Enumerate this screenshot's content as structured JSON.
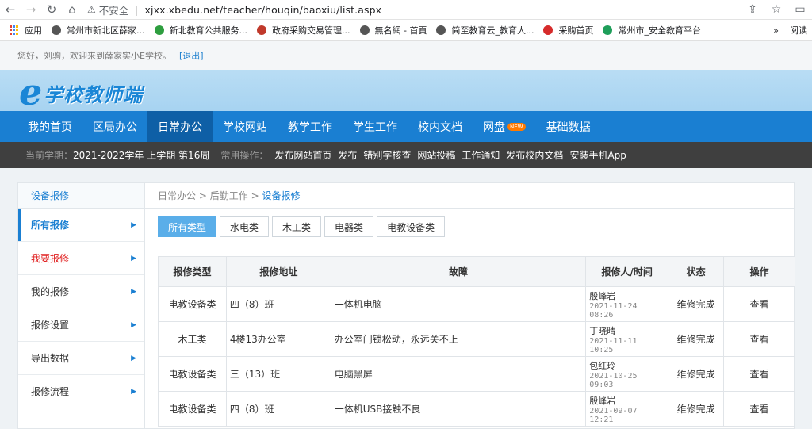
{
  "browser": {
    "insecure_label": "不安全",
    "url": "xjxx.xbedu.net/teacher/houqin/baoxiu/list.aspx",
    "bookmarks": [
      {
        "label": "应用",
        "color": "#e34133"
      },
      {
        "label": "常州市新北区薛家...",
        "color": "#555555"
      },
      {
        "label": "新北教育公共服务...",
        "color": "#2e9e3f"
      },
      {
        "label": "政府采购交易管理...",
        "color": "#c0392b"
      },
      {
        "label": "無名網 - 首頁",
        "color": "#555555"
      },
      {
        "label": "简至教育云_教育人...",
        "color": "#555555"
      },
      {
        "label": "采购首页",
        "color": "#d62b2b"
      },
      {
        "label": "常州市_安全教育平台",
        "color": "#1f9e5a"
      }
    ],
    "bookmarks_more": "»",
    "reading_list": "阅读"
  },
  "welcome": {
    "text": "您好，刘驹，欢迎来到薛家实小E学校。",
    "logout": "[退出]"
  },
  "logo": {
    "e": "e",
    "name": "学校教师端"
  },
  "main_nav": [
    {
      "label": "我的首页",
      "active": false,
      "badge": ""
    },
    {
      "label": "区局办公",
      "active": false,
      "badge": ""
    },
    {
      "label": "日常办公",
      "active": true,
      "badge": ""
    },
    {
      "label": "学校网站",
      "active": false,
      "badge": ""
    },
    {
      "label": "教学工作",
      "active": false,
      "badge": ""
    },
    {
      "label": "学生工作",
      "active": false,
      "badge": ""
    },
    {
      "label": "校内文档",
      "active": false,
      "badge": ""
    },
    {
      "label": "网盘",
      "active": false,
      "badge": "NEW"
    },
    {
      "label": "基础数据",
      "active": false,
      "badge": ""
    }
  ],
  "sub_nav": {
    "term_label": "当前学期：",
    "term": "2021-2022学年 上学期 第16周",
    "ops_label": "常用操作：",
    "ops": [
      "发布网站首页",
      "发布",
      "错别字核查",
      "网站投稿",
      "工作通知",
      "发布校内文档",
      "安装手机App"
    ]
  },
  "sidebar": {
    "title": "设备报修",
    "items": [
      {
        "label": "所有报修",
        "state": "active"
      },
      {
        "label": "我要报修",
        "state": "red"
      },
      {
        "label": "我的报修",
        "state": ""
      },
      {
        "label": "报修设置",
        "state": ""
      },
      {
        "label": "导出数据",
        "state": ""
      },
      {
        "label": "报修流程",
        "state": ""
      }
    ]
  },
  "breadcrumb": {
    "parts": [
      "日常办公",
      "后勤工作"
    ],
    "current": "设备报修",
    "separator": ">"
  },
  "filters": [
    {
      "label": "所有类型",
      "active": true
    },
    {
      "label": "水电类",
      "active": false
    },
    {
      "label": "木工类",
      "active": false
    },
    {
      "label": "电器类",
      "active": false
    },
    {
      "label": "电教设备类",
      "active": false
    }
  ],
  "table": {
    "headers": [
      "报修类型",
      "报修地址",
      "故障",
      "报修人/时间",
      "状态",
      "操作"
    ],
    "rows": [
      {
        "type": "电教设备类",
        "address": "四（8）班",
        "fault": "一体机电脑",
        "reporter": "殷峰岩",
        "time": "2021-11-24 08:26",
        "status": "维修完成",
        "action": "查看"
      },
      {
        "type": "木工类",
        "address": "4楼13办公室",
        "fault": "办公室门锁松动，永远关不上",
        "reporter": "丁晓晴",
        "time": "2021-11-11 10:25",
        "status": "维修完成",
        "action": "查看"
      },
      {
        "type": "电教设备类",
        "address": "三（13）班",
        "fault": "电脑黑屏",
        "reporter": "包红玲",
        "time": "2021-10-25 09:03",
        "status": "维修完成",
        "action": "查看"
      },
      {
        "type": "电教设备类",
        "address": "四（8）班",
        "fault": "一体机USB接触不良",
        "reporter": "殷峰岩",
        "time": "2021-09-07 12:21",
        "status": "维修完成",
        "action": "查看"
      }
    ]
  }
}
